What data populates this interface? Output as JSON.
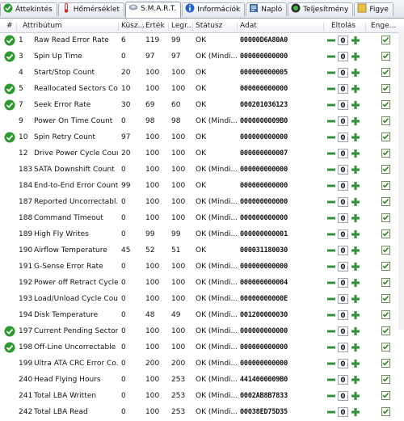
{
  "tabs": [
    {
      "label": "Áttekintés",
      "icon": "green-check-icon",
      "active": false
    },
    {
      "label": "Hőmérséklet",
      "icon": "thermometer-icon",
      "active": false
    },
    {
      "label": "S.M.A.R.T.",
      "icon": "hdd-icon",
      "active": true
    },
    {
      "label": "Információk",
      "icon": "info-icon",
      "active": false
    },
    {
      "label": "Napló",
      "icon": "log-icon",
      "active": false
    },
    {
      "label": "Teljesítmény",
      "icon": "performance-icon",
      "active": false
    },
    {
      "label": "Figye",
      "icon": "monitor-icon",
      "active": false
    }
  ],
  "columns": {
    "num": "#",
    "attribute": "Attribútum",
    "threshold": "Küsz...",
    "value": "Érték",
    "worst": "Legr...",
    "status": "Státusz",
    "data": "Adat",
    "offset": "Eltolás",
    "allowed": "Enge..."
  },
  "rows": [
    {
      "ok": true,
      "id": "1",
      "name": "Raw Read Error Rate",
      "thr": "6",
      "val": "119",
      "worst": "99",
      "status": "OK",
      "data": "00000D6A80A0",
      "off": "0",
      "allowed": true
    },
    {
      "ok": true,
      "id": "3",
      "name": "Spin Up Time",
      "thr": "0",
      "val": "97",
      "worst": "97",
      "status": "OK (Mindi...",
      "data": "000000000000",
      "off": "0",
      "allowed": true
    },
    {
      "ok": false,
      "id": "4",
      "name": "Start/Stop Count",
      "thr": "20",
      "val": "100",
      "worst": "100",
      "status": "OK",
      "data": "000000000005",
      "off": "0",
      "allowed": true
    },
    {
      "ok": true,
      "id": "5",
      "name": "Reallocated Sectors Co...",
      "thr": "10",
      "val": "100",
      "worst": "100",
      "status": "OK",
      "data": "000000000000",
      "off": "0",
      "allowed": true
    },
    {
      "ok": true,
      "id": "7",
      "name": "Seek Error Rate",
      "thr": "30",
      "val": "69",
      "worst": "60",
      "status": "OK",
      "data": "000201036123",
      "off": "0",
      "allowed": true
    },
    {
      "ok": false,
      "id": "9",
      "name": "Power On Time Count",
      "thr": "0",
      "val": "98",
      "worst": "98",
      "status": "OK (Mindi...",
      "data": "0000000009B0",
      "off": "0",
      "allowed": true
    },
    {
      "ok": true,
      "id": "10",
      "name": "Spin Retry Count",
      "thr": "97",
      "val": "100",
      "worst": "100",
      "status": "OK",
      "data": "000000000000",
      "off": "0",
      "allowed": true
    },
    {
      "ok": false,
      "id": "12",
      "name": "Drive Power Cycle Count",
      "thr": "20",
      "val": "100",
      "worst": "100",
      "status": "OK",
      "data": "000000000007",
      "off": "0",
      "allowed": true
    },
    {
      "ok": false,
      "id": "183",
      "name": "SATA Downshift Count",
      "thr": "0",
      "val": "100",
      "worst": "100",
      "status": "OK (Mindi...",
      "data": "000000000000",
      "off": "0",
      "allowed": true
    },
    {
      "ok": false,
      "id": "184",
      "name": "End-to-End Error Count",
      "thr": "99",
      "val": "100",
      "worst": "100",
      "status": "OK",
      "data": "000000000000",
      "off": "0",
      "allowed": true
    },
    {
      "ok": false,
      "id": "187",
      "name": "Reported Uncorrectabl...",
      "thr": "0",
      "val": "100",
      "worst": "100",
      "status": "OK (Mindi...",
      "data": "000000000000",
      "off": "0",
      "allowed": true
    },
    {
      "ok": false,
      "id": "188",
      "name": "Command Timeout",
      "thr": "0",
      "val": "100",
      "worst": "100",
      "status": "OK (Mindi...",
      "data": "000000000000",
      "off": "0",
      "allowed": true
    },
    {
      "ok": false,
      "id": "189",
      "name": "High Fly Writes",
      "thr": "0",
      "val": "99",
      "worst": "99",
      "status": "OK (Mindi...",
      "data": "000000000001",
      "off": "0",
      "allowed": true
    },
    {
      "ok": false,
      "id": "190",
      "name": "Airflow Temperature",
      "thr": "45",
      "val": "52",
      "worst": "51",
      "status": "OK",
      "data": "000031180030",
      "off": "0",
      "allowed": true
    },
    {
      "ok": false,
      "id": "191",
      "name": "G-Sense Error Rate",
      "thr": "0",
      "val": "100",
      "worst": "100",
      "status": "OK (Mindi...",
      "data": "000000000000",
      "off": "0",
      "allowed": true
    },
    {
      "ok": false,
      "id": "192",
      "name": "Power off Retract Cycle ...",
      "thr": "0",
      "val": "100",
      "worst": "100",
      "status": "OK (Mindi...",
      "data": "000000000004",
      "off": "0",
      "allowed": true
    },
    {
      "ok": false,
      "id": "193",
      "name": "Load/Unload Cycle Cou...",
      "thr": "0",
      "val": "100",
      "worst": "100",
      "status": "OK (Mindi...",
      "data": "00000000000E",
      "off": "0",
      "allowed": true
    },
    {
      "ok": false,
      "id": "194",
      "name": "Disk Temperature",
      "thr": "0",
      "val": "48",
      "worst": "49",
      "status": "OK (Mindi...",
      "data": "001200000030",
      "off": "0",
      "allowed": true
    },
    {
      "ok": true,
      "id": "197",
      "name": "Current Pending Sector...",
      "thr": "0",
      "val": "100",
      "worst": "100",
      "status": "OK (Mindi...",
      "data": "000000000000",
      "off": "0",
      "allowed": true
    },
    {
      "ok": true,
      "id": "198",
      "name": "Off-Line Uncorrectable ...",
      "thr": "0",
      "val": "100",
      "worst": "100",
      "status": "OK (Mindi...",
      "data": "000000000000",
      "off": "0",
      "allowed": true
    },
    {
      "ok": false,
      "id": "199",
      "name": "Ultra ATA CRC Error Co...",
      "thr": "0",
      "val": "200",
      "worst": "200",
      "status": "OK (Mindi...",
      "data": "000000000000",
      "off": "0",
      "allowed": true
    },
    {
      "ok": false,
      "id": "240",
      "name": "Head Flying Hours",
      "thr": "0",
      "val": "100",
      "worst": "253",
      "status": "OK (Mindi...",
      "data": "4414000009B0",
      "off": "0",
      "allowed": true
    },
    {
      "ok": false,
      "id": "241",
      "name": "Total LBA Written",
      "thr": "0",
      "val": "100",
      "worst": "253",
      "status": "OK (Mindi...",
      "data": "0002AB8B7833",
      "off": "0",
      "allowed": true
    },
    {
      "ok": false,
      "id": "242",
      "name": "Total LBA Read",
      "thr": "0",
      "val": "100",
      "worst": "253",
      "status": "OK (Mindi...",
      "data": "00038ED75D35",
      "off": "0",
      "allowed": true
    }
  ],
  "colors": {
    "ok_green": "#2e9a2e",
    "button_green": "#2f8f3a",
    "check_green": "#2e7d1f"
  }
}
